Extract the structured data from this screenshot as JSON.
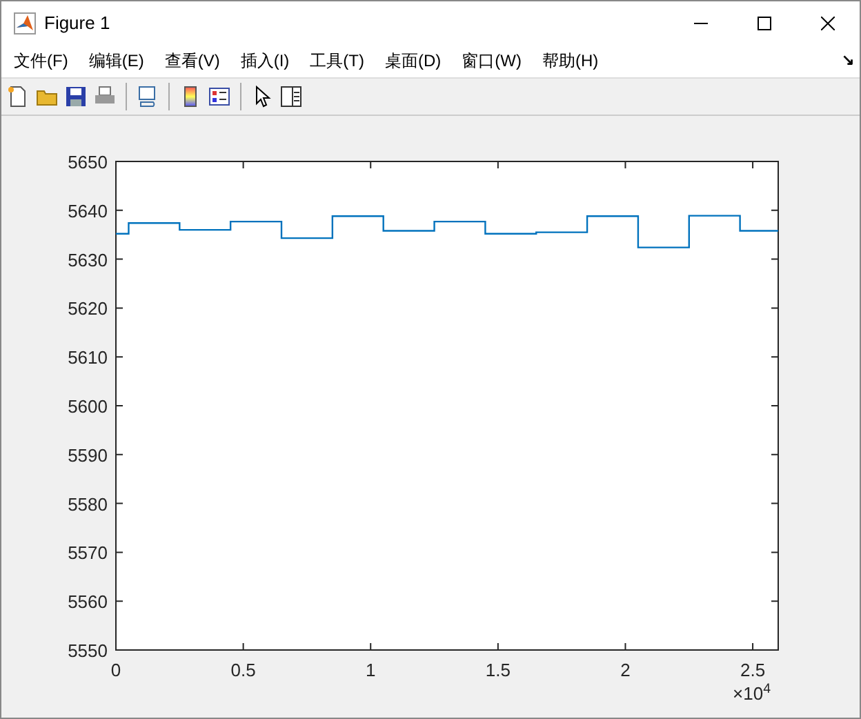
{
  "window": {
    "title": "Figure 1"
  },
  "menu": {
    "items": [
      "文件(F)",
      "编辑(E)",
      "查看(V)",
      "插入(I)",
      "工具(T)",
      "桌面(D)",
      "窗口(W)",
      "帮助(H)"
    ],
    "overflow": "↘"
  },
  "figure": {
    "chart_data": {
      "type": "line",
      "x": [
        0,
        0.05,
        0.05,
        0.25,
        0.25,
        0.45,
        0.45,
        0.65,
        0.65,
        0.85,
        0.85,
        1.05,
        1.05,
        1.25,
        1.25,
        1.45,
        1.45,
        1.65,
        1.65,
        1.85,
        1.85,
        2.05,
        2.05,
        2.25,
        2.25,
        2.45,
        2.45,
        2.6
      ],
      "series": [
        {
          "color": "#0072bd",
          "values": [
            5635.2,
            5635.2,
            5637.4,
            5637.4,
            5636,
            5636,
            5637.7,
            5637.7,
            5634.3,
            5634.3,
            5638.8,
            5638.8,
            5635.8,
            5635.8,
            5637.7,
            5637.7,
            5635.2,
            5635.2,
            5635.5,
            5635.5,
            5638.8,
            5638.8,
            5632.4,
            5632.4,
            5638.9,
            5638.9,
            5635.8,
            5635.8
          ]
        }
      ],
      "xlim": [
        0,
        2.6
      ],
      "ylim": [
        5550,
        5650
      ],
      "xticks": [
        0,
        0.5,
        1,
        1.5,
        2,
        2.5
      ],
      "yticks": [
        5550,
        5560,
        5570,
        5580,
        5590,
        5600,
        5610,
        5620,
        5630,
        5640,
        5650
      ],
      "annotations": [
        "×10$^{4}$"
      ]
    }
  }
}
